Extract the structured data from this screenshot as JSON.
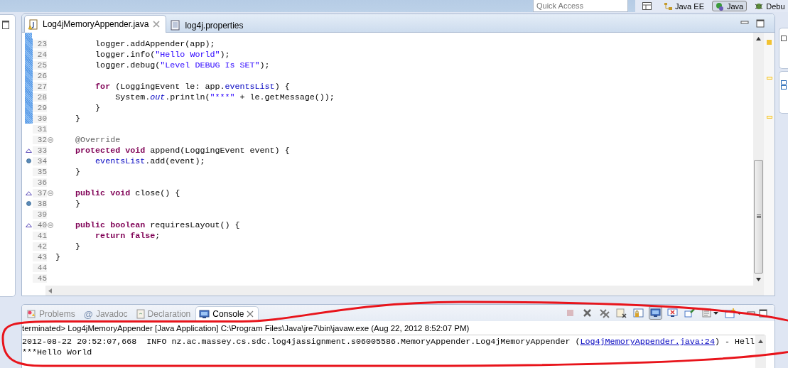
{
  "top_bar": {
    "quick_access": {
      "placeholder": "Quick Access"
    },
    "perspectives": [
      {
        "label": "Java EE",
        "kind": "javaee",
        "selected": false
      },
      {
        "label": "Java",
        "kind": "java",
        "selected": true
      },
      {
        "label": "Debu",
        "kind": "debug",
        "selected": false
      }
    ]
  },
  "editor": {
    "tabs": [
      {
        "label": "Log4jMemoryAppender.java",
        "kind": "java",
        "selected": true
      },
      {
        "label": "log4j.properties",
        "kind": "properties",
        "selected": false
      }
    ],
    "lines": [
      {
        "number": "23",
        "changed": true,
        "fold": false,
        "override": false,
        "occurrence": false,
        "tokens": [
          {
            "text": "        logger.addAppender(app);",
            "kind": "plain"
          }
        ]
      },
      {
        "number": "24",
        "changed": true,
        "fold": false,
        "override": false,
        "occurrence": false,
        "tokens": [
          {
            "text": "        logger.info(",
            "kind": "plain"
          },
          {
            "text": "\"Hello World\"",
            "kind": "string"
          },
          {
            "text": ");",
            "kind": "plain"
          }
        ]
      },
      {
        "number": "25",
        "changed": true,
        "fold": false,
        "override": false,
        "occurrence": false,
        "tokens": [
          {
            "text": "        logger.debug(",
            "kind": "plain"
          },
          {
            "text": "\"Level DEBUG Is SET\"",
            "kind": "string"
          },
          {
            "text": ");",
            "kind": "plain"
          }
        ]
      },
      {
        "number": "26",
        "changed": true,
        "fold": false,
        "override": false,
        "occurrence": false
      },
      {
        "number": "27",
        "changed": true,
        "fold": false,
        "override": false,
        "occurrence": false,
        "tokens": [
          {
            "text": "        for",
            "kind": "keyword"
          },
          {
            "text": " (LoggingEvent le: app.",
            "kind": "plain"
          },
          {
            "text": "eventsList",
            "kind": "field"
          },
          {
            "text": ") {",
            "kind": "plain"
          }
        ]
      },
      {
        "number": "28",
        "changed": true,
        "fold": false,
        "override": false,
        "occurrence": false,
        "tokens": [
          {
            "text": "            System.",
            "kind": "plain"
          },
          {
            "text": "out",
            "kind": "static"
          },
          {
            "text": ".println(",
            "kind": "plain"
          },
          {
            "text": "\"***\"",
            "kind": "string"
          },
          {
            "text": " + le.getMessage());",
            "kind": "plain"
          }
        ]
      },
      {
        "number": "29",
        "changed": true,
        "fold": false,
        "override": false,
        "occurrence": false,
        "tokens": [
          {
            "text": "        }",
            "kind": "plain"
          }
        ]
      },
      {
        "number": "30",
        "changed": true,
        "fold": false,
        "override": false,
        "occurrence": false,
        "tokens": [
          {
            "text": "    }",
            "kind": "plain"
          }
        ]
      },
      {
        "number": "31",
        "changed": false,
        "fold": false,
        "override": false,
        "occurrence": false
      },
      {
        "number": "32",
        "changed": false,
        "fold": true,
        "override": false,
        "occurrence": false,
        "tokens": [
          {
            "text": "    @Override",
            "kind": "annotation"
          }
        ]
      },
      {
        "number": "33",
        "changed": false,
        "fold": false,
        "override": true,
        "occurrence": false,
        "tokens": [
          {
            "text": "    protected",
            "kind": "keyword"
          },
          {
            "text": " void",
            "kind": "keyword"
          },
          {
            "text": " append(LoggingEvent event) {",
            "kind": "plain"
          }
        ]
      },
      {
        "number": "34",
        "changed": false,
        "fold": false,
        "override": false,
        "occurrence": true,
        "tokens": [
          {
            "text": "        eventsList",
            "kind": "field"
          },
          {
            "text": ".add(event);",
            "kind": "plain"
          }
        ]
      },
      {
        "number": "35",
        "changed": false,
        "fold": false,
        "override": false,
        "occurrence": false,
        "tokens": [
          {
            "text": "    }",
            "kind": "plain"
          }
        ]
      },
      {
        "number": "36",
        "changed": false,
        "fold": false,
        "override": false,
        "occurrence": false
      },
      {
        "number": "37",
        "changed": false,
        "fold": true,
        "override": true,
        "occurrence": false,
        "tokens": [
          {
            "text": "    public",
            "kind": "keyword"
          },
          {
            "text": " void",
            "kind": "keyword"
          },
          {
            "text": " close() {",
            "kind": "plain"
          }
        ]
      },
      {
        "number": "38",
        "changed": false,
        "fold": false,
        "override": false,
        "occurrence": true,
        "tokens": [
          {
            "text": "    }",
            "kind": "plain"
          }
        ]
      },
      {
        "number": "39",
        "changed": false,
        "fold": false,
        "override": false,
        "occurrence": false
      },
      {
        "number": "40",
        "changed": false,
        "fold": true,
        "override": true,
        "occurrence": false,
        "tokens": [
          {
            "text": "    public",
            "kind": "keyword"
          },
          {
            "text": " boolean",
            "kind": "keyword"
          },
          {
            "text": " requiresLayout() {",
            "kind": "plain"
          }
        ]
      },
      {
        "number": "41",
        "changed": false,
        "fold": false,
        "override": false,
        "occurrence": false,
        "tokens": [
          {
            "text": "        return",
            "kind": "keyword"
          },
          {
            "text": " false",
            "kind": "keyword"
          },
          {
            "text": ";",
            "kind": "plain"
          }
        ]
      },
      {
        "number": "42",
        "changed": false,
        "fold": false,
        "override": false,
        "occurrence": false,
        "tokens": [
          {
            "text": "    }",
            "kind": "plain"
          }
        ]
      },
      {
        "number": "43",
        "changed": false,
        "fold": false,
        "override": false,
        "occurrence": false,
        "tokens": [
          {
            "text": "}",
            "kind": "plain"
          }
        ]
      },
      {
        "number": "44",
        "changed": false,
        "fold": false,
        "override": false,
        "occurrence": false
      },
      {
        "number": "45",
        "changed": false,
        "fold": false,
        "override": false,
        "occurrence": false
      }
    ]
  },
  "console": {
    "tabs": [
      {
        "label": "Problems",
        "kind": "problems",
        "selected": false
      },
      {
        "label": "Javadoc",
        "kind": "javadoc",
        "glyph": "@",
        "selected": false
      },
      {
        "label": "Declaration",
        "kind": "declaration",
        "selected": false
      },
      {
        "label": "Console",
        "kind": "console",
        "selected": true
      }
    ],
    "toolbar": [
      {
        "kind": "stop",
        "disabled": true,
        "selected": false
      },
      {
        "kind": "remove",
        "disabled": false,
        "selected": false
      },
      {
        "kind": "remove-all",
        "disabled": false,
        "selected": false
      },
      {
        "kind": "clear",
        "disabled": false,
        "selected": false
      },
      {
        "kind": "lock",
        "disabled": false,
        "selected": false
      },
      {
        "kind": "monitor",
        "disabled": false,
        "selected": true
      },
      {
        "kind": "monitor-error",
        "disabled": false,
        "selected": false
      },
      {
        "kind": "pin",
        "disabled": false,
        "selected": false
      },
      {
        "kind": "display",
        "disabled": false,
        "selected": false
      },
      {
        "kind": "new-console",
        "disabled": false,
        "selected": false
      }
    ],
    "process": "terminated> Log4jMemoryAppender [Java Application] C:\\Program Files\\Java\\jre7\\bin\\javaw.exe (Aug 22, 2012 8:52:07 PM)",
    "output": [
      [
        {
          "text": "2012-08-22 20:52:07,668  INFO nz.ac.massey.cs.sdc.log4jassignment.s06005586.MemoryAppender.Log4jMemoryAppender (",
          "kind": "plain"
        },
        {
          "text": "Log4jMemoryAppender.java:24",
          "kind": "link"
        },
        {
          "text": ") - Hell",
          "kind": "plain"
        }
      ],
      [
        {
          "text": "***Hello World",
          "kind": "plain"
        }
      ]
    ]
  },
  "annotation": {
    "kind": "ellipse"
  }
}
